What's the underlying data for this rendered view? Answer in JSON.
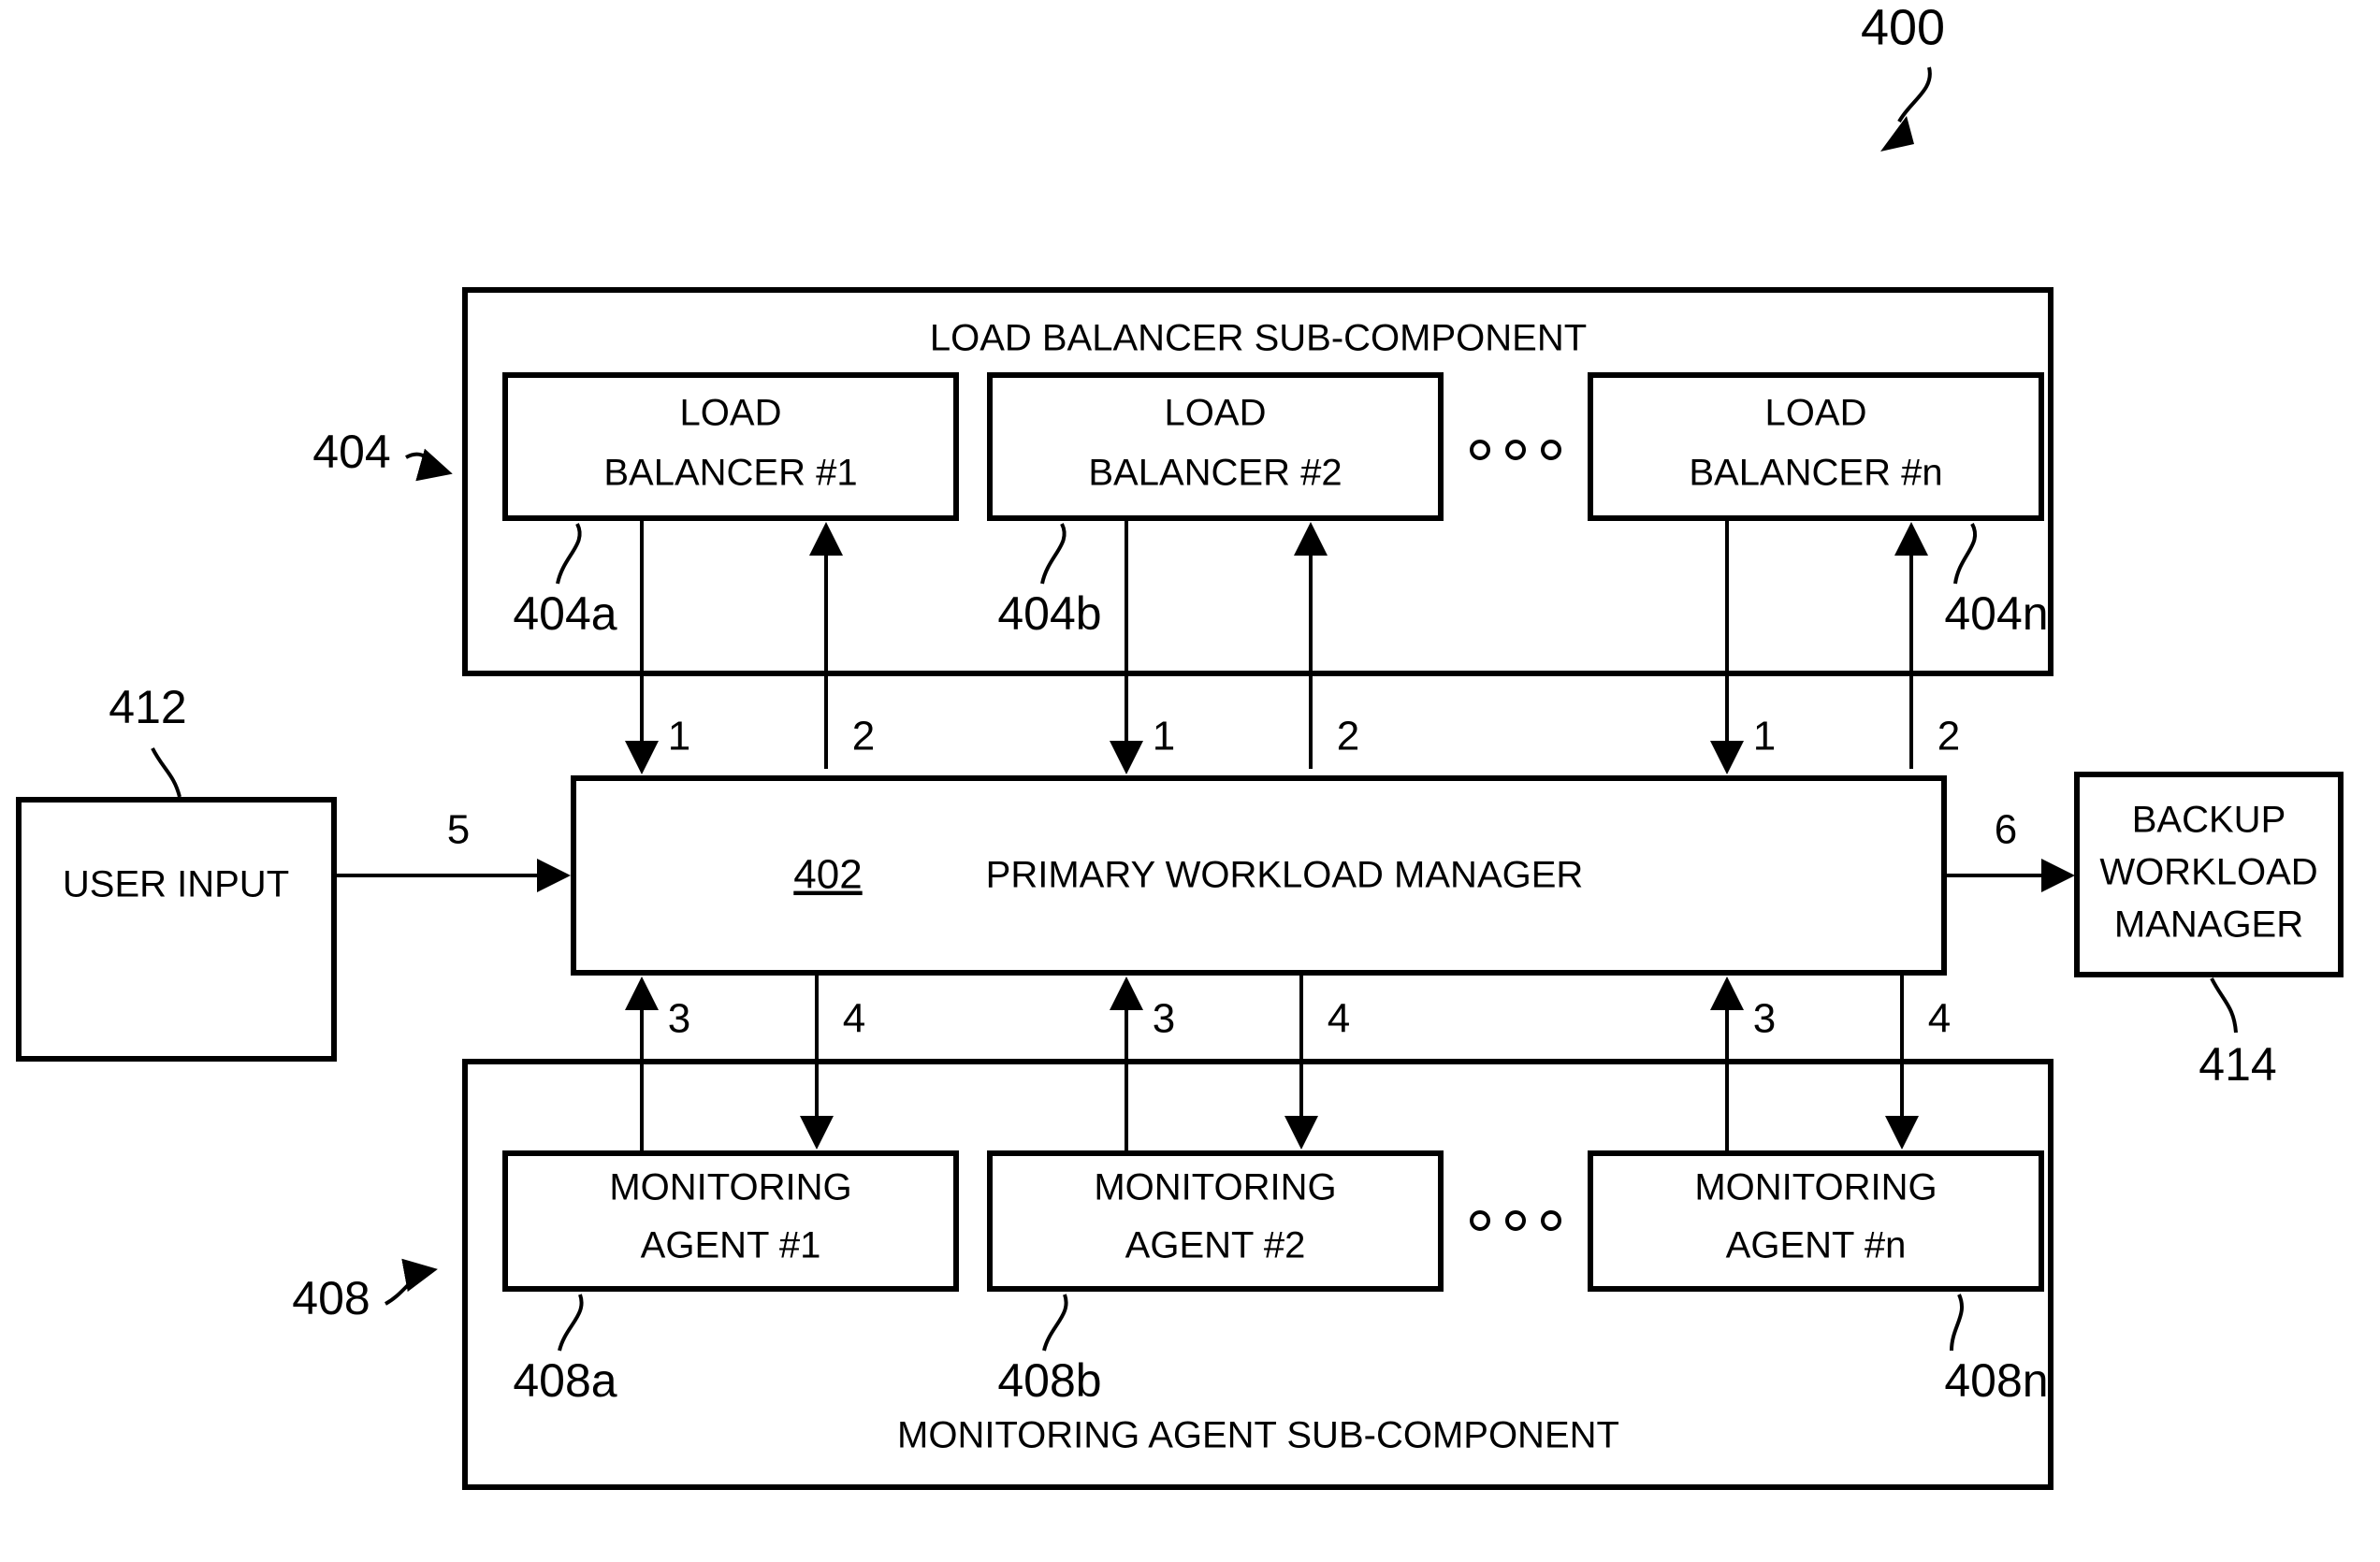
{
  "figure": {
    "number": "400",
    "type": "patent-block-diagram"
  },
  "load_balancer_section": {
    "title": "LOAD BALANCER SUB-COMPONENT",
    "ref": "404",
    "ellipsis": "o o o",
    "items": [
      {
        "line1": "LOAD",
        "line2": "BALANCER #1",
        "ref": "404a"
      },
      {
        "line1": "LOAD",
        "line2": "BALANCER #2",
        "ref": "404b"
      },
      {
        "line1": "LOAD",
        "line2": "BALANCER #n",
        "ref": "404n"
      }
    ]
  },
  "primary_manager": {
    "ref": "402",
    "label": "PRIMARY WORKLOAD MANAGER"
  },
  "user_input": {
    "label": "USER INPUT",
    "ref": "412"
  },
  "backup_manager": {
    "line1": "BACKUP",
    "line2": "WORKLOAD",
    "line3": "MANAGER",
    "ref": "414"
  },
  "monitoring_section": {
    "title": "MONITORING AGENT SUB-COMPONENT",
    "ref": "408",
    "ellipsis": "o o o",
    "items": [
      {
        "line1": "MONITORING",
        "line2": "AGENT #1",
        "ref": "408a"
      },
      {
        "line1": "MONITORING",
        "line2": "AGENT #2",
        "ref": "408b"
      },
      {
        "line1": "MONITORING",
        "line2": "AGENT #n",
        "ref": "408n"
      }
    ]
  },
  "flow_labels": {
    "lb_down_1": "1",
    "lb_up_1": "2",
    "lb_down_2": "1",
    "lb_up_2": "2",
    "lb_down_n": "1",
    "lb_up_n": "2",
    "ma_up_1": "3",
    "ma_down_1": "4",
    "ma_up_2": "3",
    "ma_down_2": "4",
    "ma_up_n": "3",
    "ma_down_n": "4",
    "user_to_primary": "5",
    "primary_to_backup": "6"
  },
  "colors": {
    "stroke": "#000000",
    "fill": "#ffffff"
  }
}
